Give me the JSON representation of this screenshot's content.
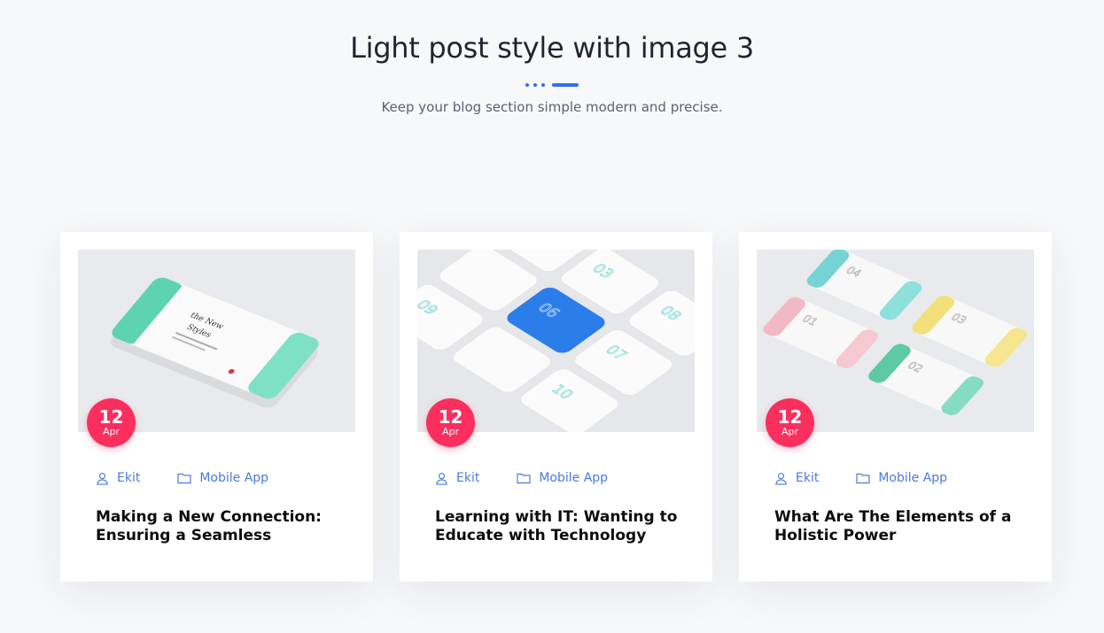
{
  "section": {
    "title": "Light post style with image 3",
    "subtitle": "Keep your blog section simple modern and precise."
  },
  "colors": {
    "accent": "#2f6ff0",
    "badge": "#fb2f5e",
    "meta": "#4a7bd8"
  },
  "posts": [
    {
      "image": "phone-mockup-teal",
      "day": "12",
      "month": "Apr",
      "author": "Ekit",
      "category": "Mobile App",
      "title": "Making a New Connection: Ensuring a Seamless"
    },
    {
      "image": "phone-grid-numbers",
      "day": "12",
      "month": "Apr",
      "author": "Ekit",
      "category": "Mobile App",
      "title": "Learning with IT: Wanting to Educate with Technology"
    },
    {
      "image": "phone-mockups-pastel",
      "day": "12",
      "month": "Apr",
      "author": "Ekit",
      "category": "Mobile App",
      "title": "What Are The Elements of a Holistic Power"
    }
  ]
}
